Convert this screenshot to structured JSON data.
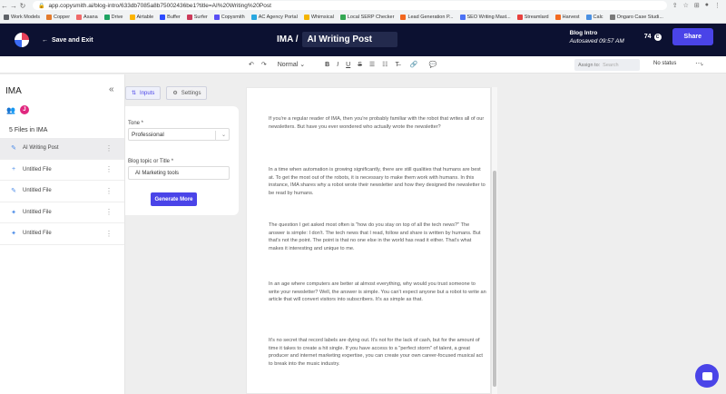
{
  "browser": {
    "url": "app.copysmith.ai/blog-intro/633db7085a8b75002436be1?title=AI%20Writing%20Post",
    "bookmarks": [
      "Work Models",
      "Copper",
      "Asana",
      "Drive",
      "Airtable",
      "Buffer",
      "Surfer",
      "Copysmith",
      "AC Agency Portal",
      "Whimsical",
      "Local SERP Checker",
      "Lead Generation P...",
      "SEO Writing Mast...",
      "Streamlard",
      "Harvest",
      "Calc",
      "Ongaro Case Studi..."
    ],
    "bookmark_colors": [
      "#5f6368",
      "#e37b2c",
      "#f06a6a",
      "#1fa463",
      "#fcb400",
      "#2c4bff",
      "#cc3a5a",
      "#5a4ff5",
      "#2aa8e0",
      "#f4b400",
      "#34a853",
      "#f2671f",
      "#4b72f5",
      "#e8413e",
      "#f36b21",
      "#4a90e2",
      "#7a7a7a"
    ]
  },
  "header": {
    "back_label": "Save and Exit",
    "folder": "IMA /",
    "doc_title": "AI Writing Post",
    "tool_name": "Blog Intro",
    "autosave": "Autosaved 09:57 AM",
    "credits": "74",
    "credits_icon": "C",
    "share_label": "Share"
  },
  "toolbar": {
    "undo_icon": "↶",
    "redo_icon": "↷",
    "style_value": "Normal",
    "bold": "B",
    "italic": "I",
    "underline": "U",
    "strike": "S",
    "assign_label": "Assign to:",
    "assign_placeholder": "Search",
    "status_value": "No status",
    "status_chevron": "⌄",
    "more": "⋯"
  },
  "sidebar": {
    "title": "IMA",
    "collapse_icon": "«",
    "avatar_letter": "J",
    "file_count_label": "5 Files in IMA",
    "files": [
      {
        "label": "AI Writing Post",
        "icon": "✎",
        "active": true
      },
      {
        "label": "Untitled File",
        "icon": "+",
        "active": false
      },
      {
        "label": "Untitled File",
        "icon": "✎",
        "active": false
      },
      {
        "label": "Untitled File",
        "icon": "✦",
        "active": false
      },
      {
        "label": "Untitled File",
        "icon": "✦",
        "active": false
      }
    ]
  },
  "panel": {
    "tab_inputs": "Inputs",
    "tab_settings": "Settings",
    "tone_label": "Tone *",
    "tone_value": "Professional",
    "topic_label": "Blog topic or Title *",
    "topic_value": "AI Marketing tools",
    "generate_label": "Generate More"
  },
  "document": {
    "paragraphs": [
      "If you're a regular reader of IMA, then you're probably familiar with the robot that writes all of our newsletters. But have you ever wondered who actually wrote the newsletter?",
      "In a time when automation is growing significantly, there are still qualities that humans are best at. To get the most out of the robots, it is necessary to make them work with humans. In this instance, IMA shares why a robot wrote their newsletter and how they designed the newsletter to be read by humans.",
      "The question I get asked most often is \"how do you stay on top of all the tech news?\" The answer is simple: I don't. The tech news that I read, follow and share is written by humans. But that's not the point. The point is that no one else in the world has read it either. That's what makes it interesting and unique to me.",
      "In an age where computers are better at almost everything, why would you trust someone to write your newsletter? Well, the answer is simple. You can't expect anyone but a robot to write an article that will convert visitors into subscribers. It's as simple as that.",
      "It's no secret that record labels are dying out. It's not for the lack of cash, but for the amount of time it takes to create a hit single. If you have access to a \"perfect storm\" of talent, a great producer and internet marketing expertise, you can create your own career-focused musical act to break into the music industry."
    ]
  },
  "colors": {
    "header_bg": "#0c1131",
    "accent": "#4a44e8",
    "avatar": "#e0287f"
  }
}
